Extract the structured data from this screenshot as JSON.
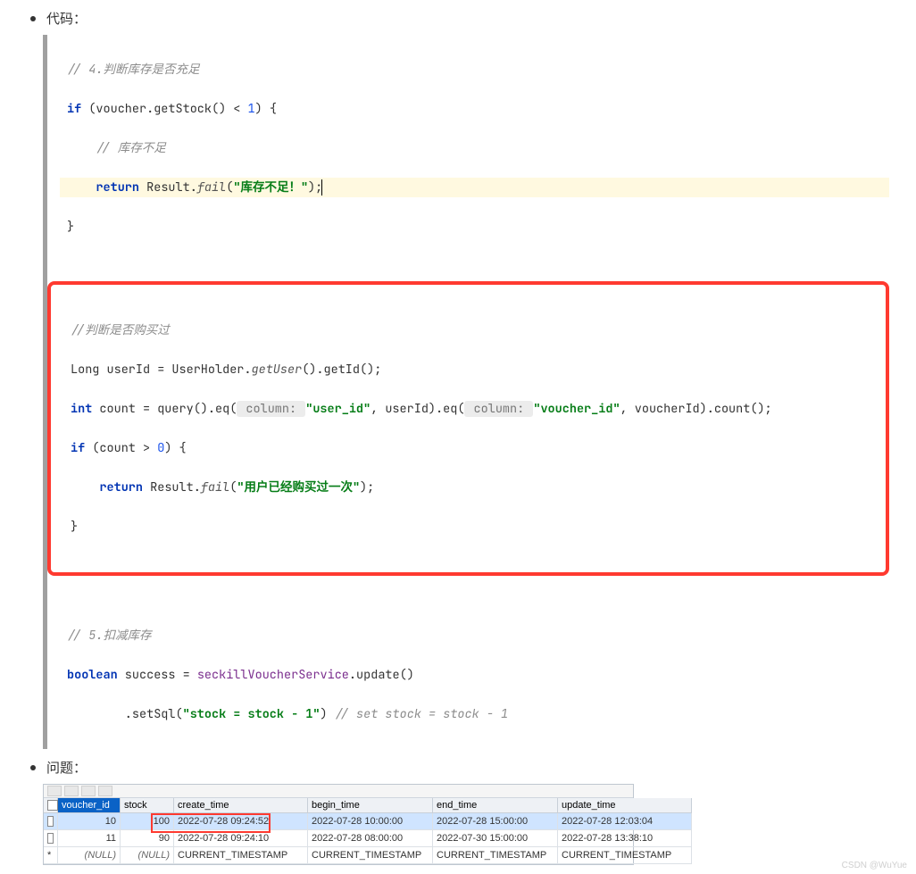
{
  "heading1": "代码：",
  "heading2": "问题：",
  "code": {
    "c1": "// 4.判断库存是否充足",
    "c2_if": "if",
    "c2_rest": " (voucher.getStock() < ",
    "c2_num": "1",
    "c2_tail": ") {",
    "c3": "// 库存不足",
    "c4_ret": "return",
    "c4_mid": " Result.",
    "c4_fail": "fail",
    "c4_open": "(",
    "c4_str": "\"库存不足！\"",
    "c4_close": ");",
    "c5": "}",
    "c6": "//判断是否购买过",
    "c7a": "Long userId = UserHolder.",
    "c7b": "getUser",
    "c7c": "().getId();",
    "c8_int": "int",
    "c8a": " count = query().eq(",
    "c8h1": " column: ",
    "c8s1": "\"user_id\"",
    "c8m": ", userId).eq(",
    "c8h2": " column: ",
    "c8s2": "\"voucher_id\"",
    "c8t": ", voucherId).count();",
    "c9_if": "if",
    "c9_rest": " (count > ",
    "c9_num": "0",
    "c9_tail": ") {",
    "c10_ret": "return",
    "c10_mid": " Result.",
    "c10_fail": "fail",
    "c10_open": "(",
    "c10_str": "\"用户已经购买过一次\"",
    "c10_close": ");",
    "c10b": "}",
    "c11": "// 5.扣减库存",
    "c12_bool": "boolean",
    "c12a": " success = ",
    "c12svc": "seckillVoucherService",
    "c12b": ".update()",
    "c13a": "        .setSql(",
    "c13s": "\"stock = stock - 1\"",
    "c13b": ") ",
    "c13c": "// set stock = stock - 1"
  },
  "table": {
    "headers": [
      "",
      "voucher_id",
      "stock",
      "create_time",
      "begin_time",
      "end_time",
      "update_time"
    ],
    "rows": [
      {
        "chk": true,
        "vid": "10",
        "stock": "100",
        "create": "2022-07-28 09:24:52",
        "begin": "2022-07-28 10:00:00",
        "end": "2022-07-28 15:00:00",
        "update": "2022-07-28 12:03:04"
      },
      {
        "chk": true,
        "vid": "11",
        "stock": "90",
        "create": "2022-07-28 09:24:10",
        "begin": "2022-07-28 08:00:00",
        "end": "2022-07-30 15:00:00",
        "update": "2022-07-28 13:38:10"
      },
      {
        "chk": false,
        "vid": "(NULL)",
        "stock": "(NULL)",
        "create": "CURRENT_TIMESTAMP",
        "begin": "CURRENT_TIMESTAMP",
        "end": "CURRENT_TIMESTAMP",
        "update": "CURRENT_TIMESTAMP"
      }
    ]
  },
  "watermark": "CSDN @WuYue"
}
